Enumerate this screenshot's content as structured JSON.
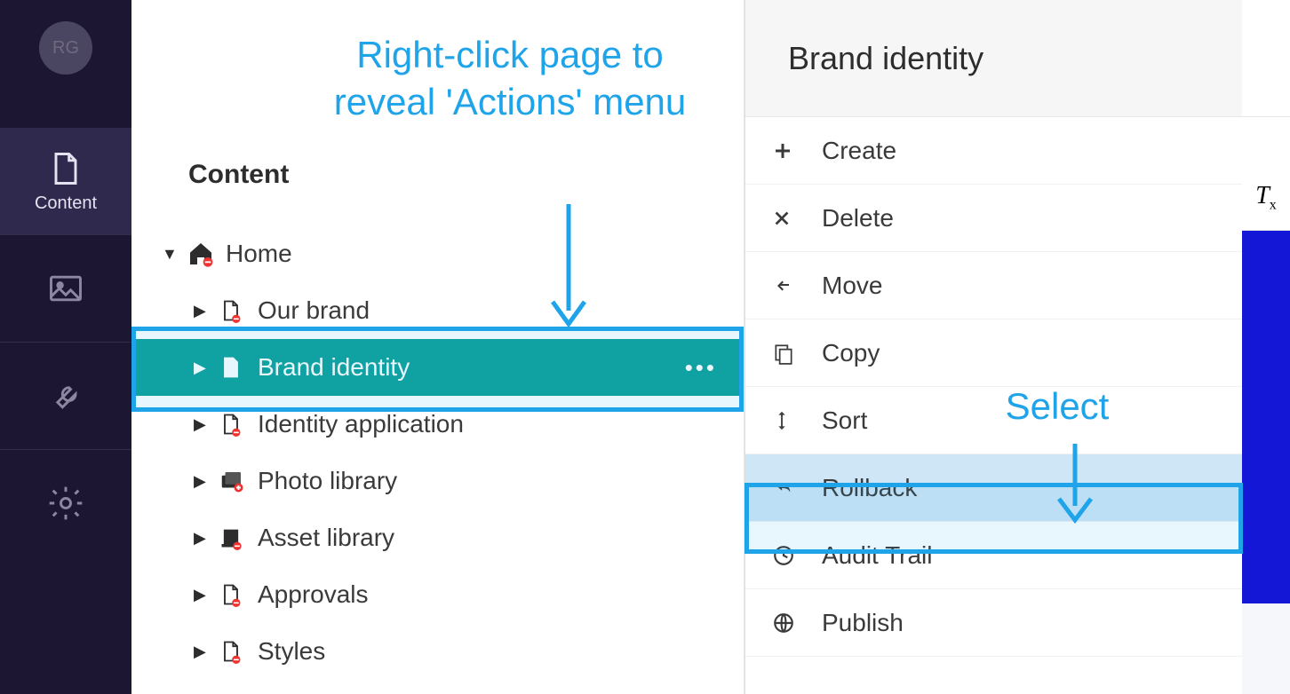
{
  "rail": {
    "avatar_initials": "RG",
    "items": [
      {
        "label": "Content",
        "active": true
      }
    ]
  },
  "content": {
    "title": "Content",
    "tree": {
      "root": {
        "label": "Home"
      },
      "children": [
        {
          "label": "Our brand"
        },
        {
          "label": "Brand identity",
          "selected": true
        },
        {
          "label": "Identity application"
        },
        {
          "label": "Photo library"
        },
        {
          "label": "Asset library"
        },
        {
          "label": "Approvals"
        },
        {
          "label": "Styles"
        }
      ]
    }
  },
  "actions": {
    "title": "Brand identity",
    "items": [
      {
        "label": "Create"
      },
      {
        "label": "Delete"
      },
      {
        "label": "Move"
      },
      {
        "label": "Copy"
      },
      {
        "label": "Sort"
      },
      {
        "label": "Rollback",
        "highlight": true
      },
      {
        "label": "Audit Trail"
      },
      {
        "label": "Publish"
      }
    ]
  },
  "annotations": {
    "reveal": "Right-click page to reveal 'Actions' menu",
    "select": "Select"
  },
  "right_strip": {
    "clear_format_glyph": "T"
  },
  "colors": {
    "accent_teal": "#0fa29b",
    "annotation_blue": "#1fa4ea",
    "rail_bg": "#1b1731",
    "right_blue": "#1418d6"
  }
}
